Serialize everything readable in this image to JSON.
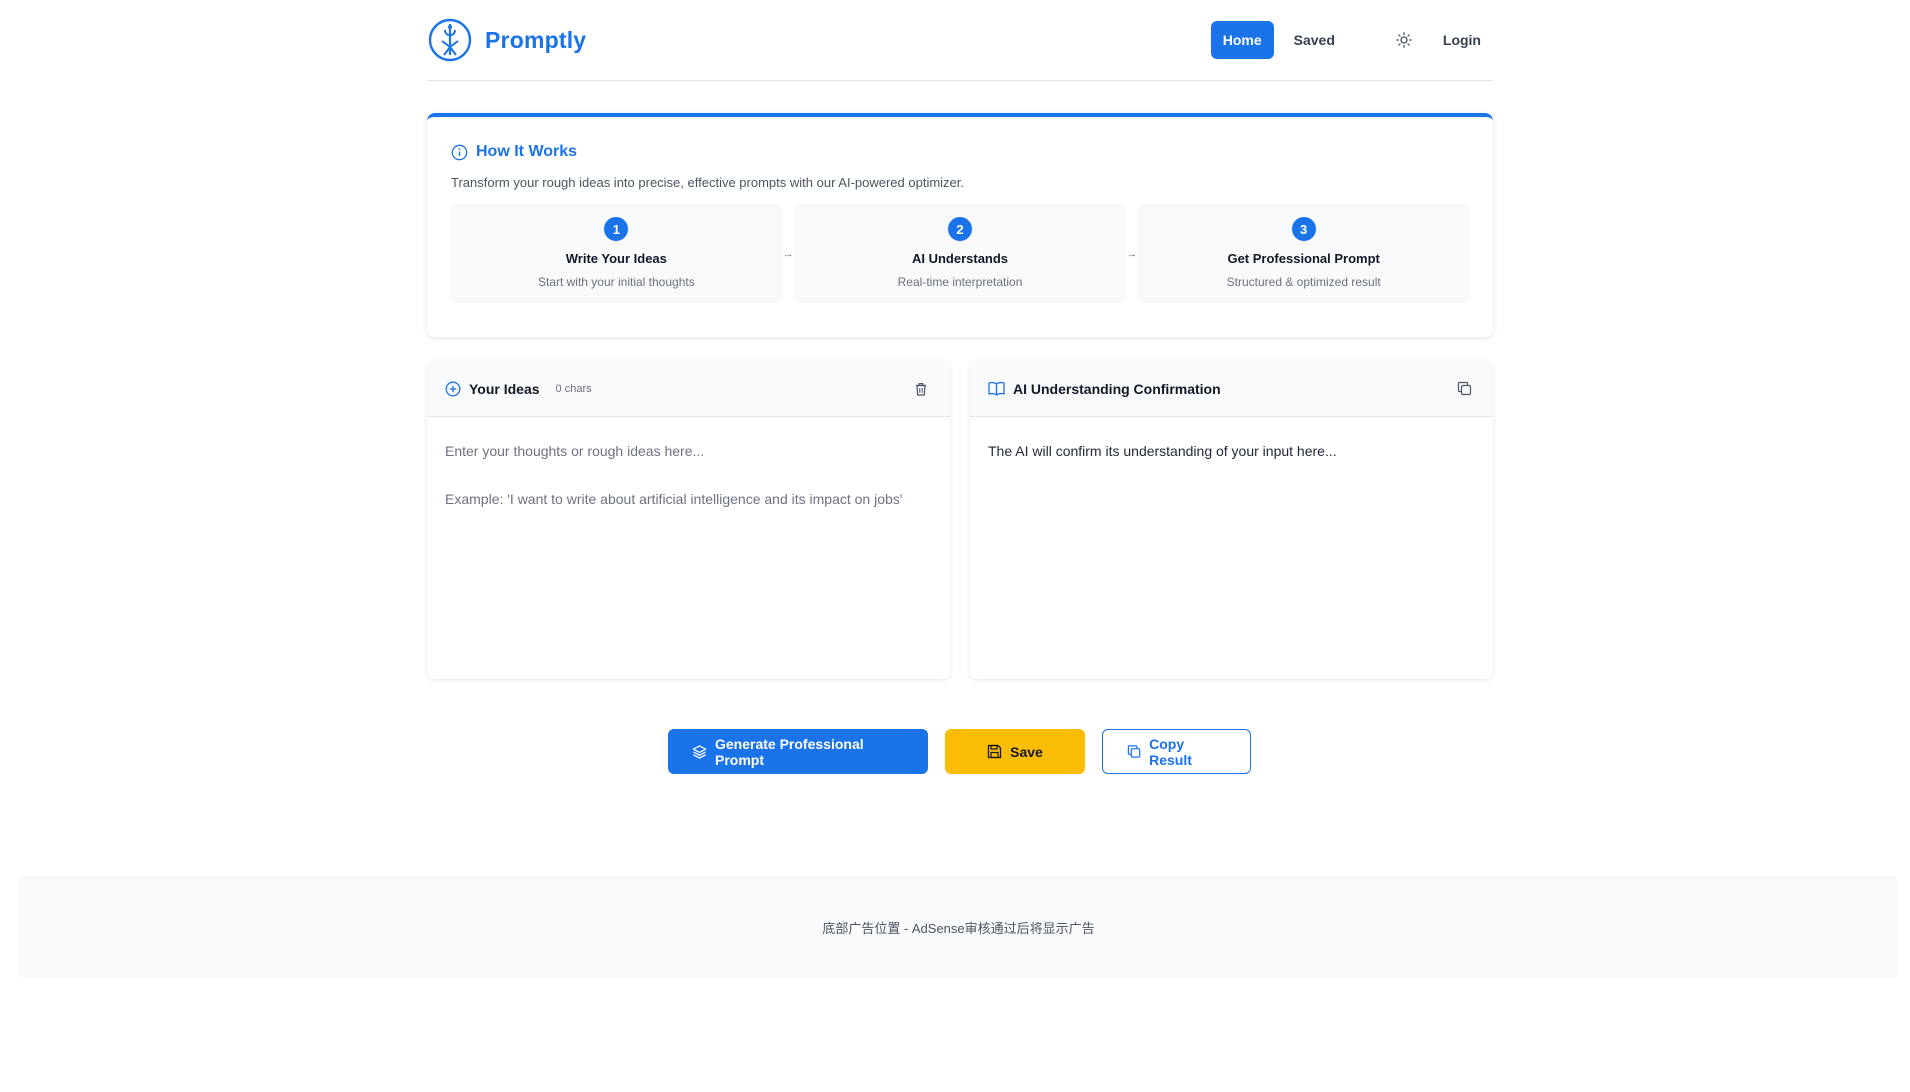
{
  "header": {
    "brand_name": "Promptly",
    "nav": {
      "home": "Home",
      "saved": "Saved",
      "login": "Login"
    }
  },
  "how_it_works": {
    "title": "How It Works",
    "description": "Transform your rough ideas into precise, effective prompts with our AI-powered optimizer.",
    "arrow": "→",
    "steps": [
      {
        "number": "1",
        "title": "Write Your Ideas",
        "subtitle": "Start with your initial thoughts"
      },
      {
        "number": "2",
        "title": "AI Understands",
        "subtitle": "Real-time interpretation"
      },
      {
        "number": "3",
        "title": "Get Professional Prompt",
        "subtitle": "Structured & optimized result"
      }
    ]
  },
  "ideas_panel": {
    "title": "Your Ideas",
    "char_count": "0 chars",
    "placeholder": "Enter your thoughts or rough ideas here...\n\nExample: 'I want to write about artificial intelligence and its impact on jobs'"
  },
  "ai_panel": {
    "title": "AI Understanding Confirmation",
    "text": "The AI will confirm its understanding of your input here..."
  },
  "actions": {
    "generate": "Generate Professional Prompt",
    "save": "Save",
    "copy": "Copy Result"
  },
  "ad": {
    "text": "底部广告位置 - AdSense审核通过后将显示广告"
  },
  "colors": {
    "accent": "#1a73e8",
    "save": "#fbbc04"
  }
}
